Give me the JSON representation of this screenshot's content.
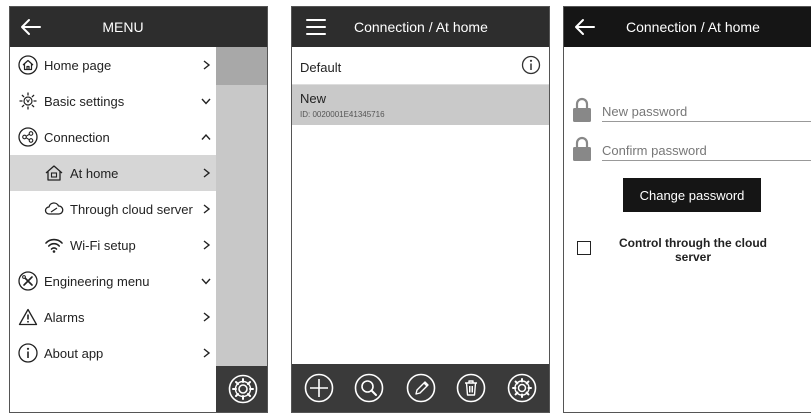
{
  "menu_screen": {
    "title": "MENU",
    "items": [
      {
        "label": "Home page",
        "icon": "home-icon",
        "chevron": "right",
        "sub": false,
        "selected": false
      },
      {
        "label": "Basic settings",
        "icon": "basic-settings-icon",
        "chevron": "down",
        "sub": false,
        "selected": false
      },
      {
        "label": "Connection",
        "icon": "share-icon",
        "chevron": "up",
        "sub": false,
        "selected": false
      },
      {
        "label": "At home",
        "icon": "house-icon",
        "chevron": "right",
        "sub": true,
        "selected": true
      },
      {
        "label": "Through cloud server",
        "icon": "cloud-icon",
        "chevron": "right",
        "sub": true,
        "selected": false
      },
      {
        "label": "Wi-Fi setup",
        "icon": "wifi-icon",
        "chevron": "right",
        "sub": true,
        "selected": false
      },
      {
        "label": "Engineering menu",
        "icon": "tools-icon",
        "chevron": "down",
        "sub": false,
        "selected": false
      },
      {
        "label": "Alarms",
        "icon": "alarm-icon",
        "chevron": "right",
        "sub": false,
        "selected": false
      },
      {
        "label": "About app",
        "icon": "info-icon",
        "chevron": "right",
        "sub": false,
        "selected": false
      }
    ]
  },
  "list_screen": {
    "title": "Connection / At home",
    "default_label": "Default",
    "new_label": "New",
    "new_id": "ID: 0020001E41345716"
  },
  "password_screen": {
    "title": "Connection / At home",
    "new_password_placeholder": "New password",
    "confirm_password_placeholder": "Confirm password",
    "change_button": "Change password",
    "cloud_label": "Control through the cloud server"
  },
  "colors": {
    "header_dark": "#2d2d2d",
    "header_black": "#151515",
    "selected_row": "#d6d6d6",
    "highlight_row": "#c9c9c9"
  }
}
